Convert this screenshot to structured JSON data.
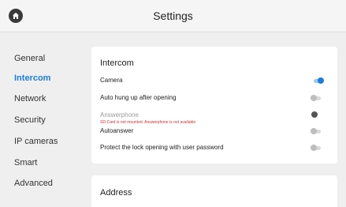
{
  "header": {
    "title": "Settings",
    "home_icon": "home-icon"
  },
  "sidebar": {
    "items": [
      {
        "label": "General"
      },
      {
        "label": "Intercom"
      },
      {
        "label": "Network"
      },
      {
        "label": "Security"
      },
      {
        "label": "IP cameras"
      },
      {
        "label": "Smart"
      },
      {
        "label": "Advanced"
      }
    ],
    "active": "Intercom"
  },
  "intercom": {
    "title": "Intercom",
    "rows": [
      {
        "label": "Camera",
        "on": true
      },
      {
        "label": "Auto hung up after opening",
        "on": false
      },
      {
        "label": "Answerphone",
        "on": false,
        "disabled": true,
        "warning": "SD-Card is not mounted. Answerphone is not available"
      },
      {
        "label": "Autoanswer",
        "on": false
      },
      {
        "label": "Protect the lock opening with user password",
        "on": false
      }
    ]
  },
  "address": {
    "title": "Address"
  },
  "colors": {
    "accent": "#1a7ee0",
    "warning": "#d32f2f",
    "background": "#efefef"
  }
}
